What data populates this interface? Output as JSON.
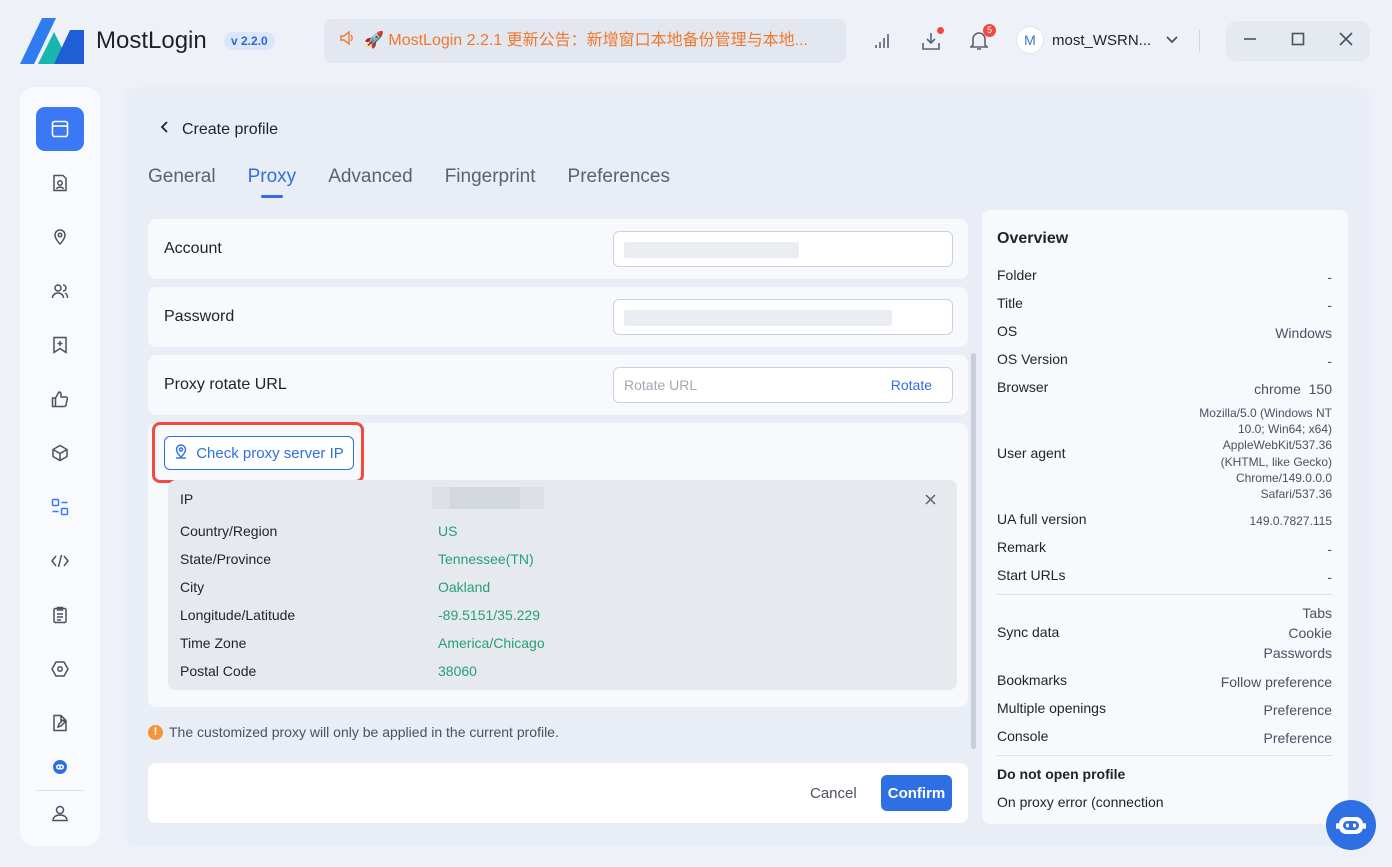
{
  "app": {
    "name": "MostLogin",
    "version": "v 2.2.0"
  },
  "announcement": {
    "text": "🚀 MostLogin 2.2.1 更新公告：新增窗口本地备份管理与本地..."
  },
  "titlebar": {
    "notification_count": "5",
    "username": "most_WSRN..."
  },
  "header": {
    "back_label": "Create profile"
  },
  "tabs": [
    {
      "label": "General"
    },
    {
      "label": "Proxy",
      "active": true
    },
    {
      "label": "Advanced"
    },
    {
      "label": "Fingerprint"
    },
    {
      "label": "Preferences"
    }
  ],
  "proxy_form": {
    "account_label": "Account",
    "password_label": "Password",
    "rotate_label": "Proxy rotate URL",
    "rotate_placeholder": "Rotate URL",
    "rotate_button": "Rotate",
    "check_button": "Check proxy server IP"
  },
  "ip_info": {
    "rows": [
      {
        "label": "IP",
        "value": ""
      },
      {
        "label": "Country/Region",
        "value": "US"
      },
      {
        "label": "State/Province",
        "value": "Tennessee(TN)"
      },
      {
        "label": "City",
        "value": "Oakland"
      },
      {
        "label": "Longitude/Latitude",
        "value": "-89.5151/35.229"
      },
      {
        "label": "Time Zone",
        "value": "America/Chicago"
      },
      {
        "label": "Postal Code",
        "value": "38060"
      }
    ]
  },
  "note": "The customized proxy will only be applied in the current profile.",
  "footer": {
    "cancel": "Cancel",
    "confirm": "Confirm"
  },
  "overview": {
    "title": "Overview",
    "rows": [
      {
        "label": "Folder",
        "value": "-"
      },
      {
        "label": "Title",
        "value": "-"
      },
      {
        "label": "OS",
        "value": "Windows"
      },
      {
        "label": "OS Version",
        "value": "-"
      },
      {
        "label": "Browser",
        "value": "chrome  150"
      },
      {
        "label": "User agent",
        "value": "Mozilla/5.0 (Windows NT\n10.0; Win64; x64)\nAppleWebKit/537.36\n(KHTML, like Gecko)\nChrome/149.0.0.0\nSafari/537.36"
      },
      {
        "label": "UA full version",
        "value": "149.0.7827.115"
      },
      {
        "label": "Remark",
        "value": "-"
      },
      {
        "label": "Start URLs",
        "value": "-"
      },
      {
        "label": "Sync data",
        "value": "Tabs\nCookie\nPasswords"
      },
      {
        "label": "Bookmarks",
        "value": "Follow preference"
      },
      {
        "label": "Multiple openings",
        "value": "Preference"
      },
      {
        "label": "Console",
        "value": "Preference"
      }
    ],
    "section_label": "Do not open profile",
    "cut_label": "On proxy error (connection"
  },
  "icons": {
    "sidebar": [
      "browser-window-icon",
      "profile-card-icon",
      "location-pin-icon",
      "users-icon",
      "bookmark-add-icon",
      "thumbs-up-icon",
      "cube-icon",
      "layout-icon",
      "code-icon",
      "clipboard-icon",
      "hexagon-settings-icon",
      "edit-doc-icon",
      "bot-small-icon",
      "user-icon"
    ]
  }
}
